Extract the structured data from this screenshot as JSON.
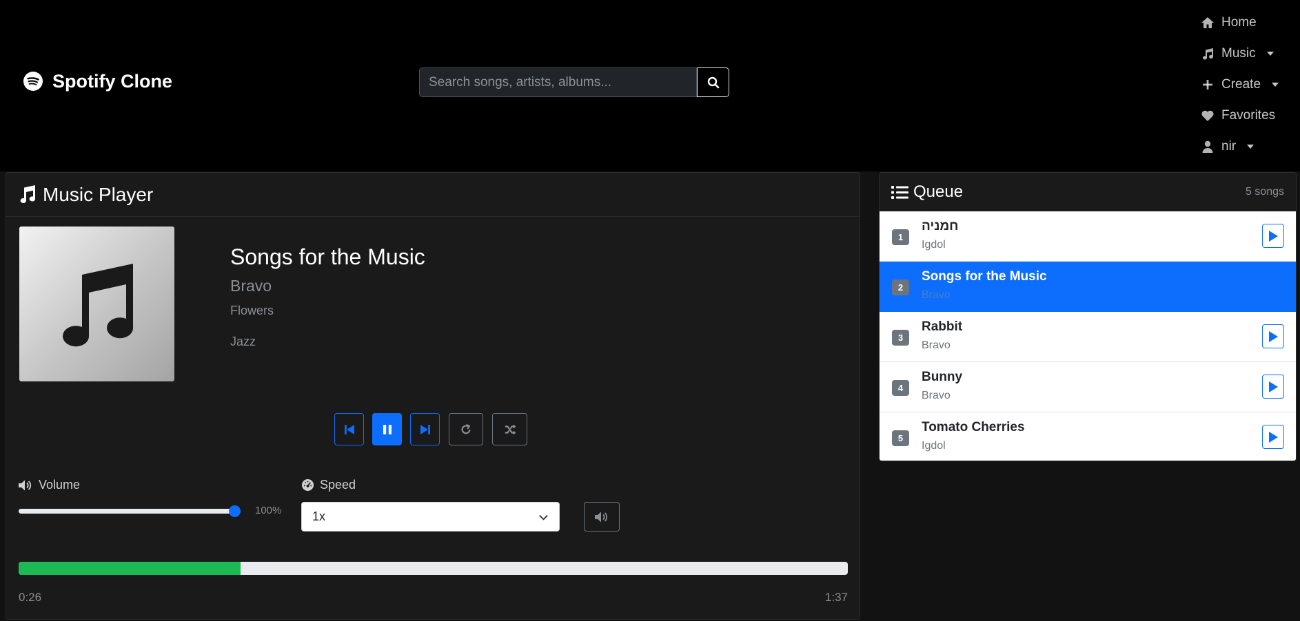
{
  "navbar": {
    "brand": "Spotify Clone",
    "search": {
      "placeholder": "Search songs, artists, albums...",
      "value": ""
    },
    "links": [
      {
        "label": "Home",
        "icon": "home-icon",
        "dropdown": false
      },
      {
        "label": "Music",
        "icon": "music-note-icon",
        "dropdown": true
      },
      {
        "label": "Create",
        "icon": "plus-icon",
        "dropdown": true
      },
      {
        "label": "Favorites",
        "icon": "heart-icon",
        "dropdown": false
      },
      {
        "label": "nir",
        "icon": "user-icon",
        "dropdown": true
      }
    ]
  },
  "player": {
    "header": "Music Player",
    "now_playing": {
      "title": "Songs for the Music",
      "artist": "Bravo",
      "album": "Flowers",
      "genre": "Jazz"
    },
    "controls": {
      "state": "playing",
      "buttons": [
        "previous-icon",
        "pause-icon",
        "next-icon",
        "repeat-icon",
        "shuffle-icon"
      ]
    },
    "volume": {
      "label": "Volume",
      "value_text": "100%",
      "level": 1.0
    },
    "speed": {
      "label": "Speed",
      "selected": "1x"
    },
    "progress": {
      "current": "0:26",
      "total": "1:37",
      "fraction": 0.268
    }
  },
  "queue": {
    "header": "Queue",
    "count": "5 songs",
    "items": [
      {
        "num": "1",
        "title": "חמניה",
        "artist": "Igdol",
        "active": false
      },
      {
        "num": "2",
        "title": "Songs for the Music",
        "artist": "Bravo",
        "active": true
      },
      {
        "num": "3",
        "title": "Rabbit",
        "artist": "Bravo",
        "active": false
      },
      {
        "num": "4",
        "title": "Bunny",
        "artist": "Bravo",
        "active": false
      },
      {
        "num": "5",
        "title": "Tomato Cherries",
        "artist": "Igdol",
        "active": false
      }
    ]
  },
  "colors": {
    "accent": "#0d6efd",
    "progress": "#1db954",
    "background": "#000000",
    "card": "#1a1a1a"
  }
}
